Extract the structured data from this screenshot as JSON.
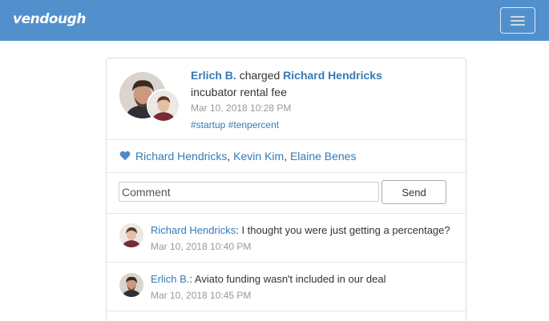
{
  "app": {
    "brand": "vendough"
  },
  "transaction": {
    "actor": "Erlich B.",
    "verb": "charged",
    "target": "Richard Hendricks",
    "description": "incubator rental fee",
    "timestamp": "Mar 10, 2018 10:28 PM",
    "tags": "#startup #tenpercent"
  },
  "likes": {
    "icon": "heart-icon",
    "names": [
      "Richard Hendricks",
      "Kevin Kim",
      "Elaine Benes"
    ],
    "separator": ", "
  },
  "comment_form": {
    "placeholder": "Comment",
    "send_label": "Send"
  },
  "comments": [
    {
      "author": "Richard Hendricks",
      "separator": ":",
      "text": " I thought you were just getting a percentage?",
      "timestamp": "Mar 10, 2018 10:40 PM"
    },
    {
      "author": "Erlich B.",
      "separator": ":",
      "text": " Aviato funding wasn't included in our deal",
      "timestamp": "Mar 10, 2018 10:45 PM"
    }
  ],
  "colors": {
    "navbar": "#5190cc",
    "link": "#337ab7",
    "muted": "#999999"
  }
}
